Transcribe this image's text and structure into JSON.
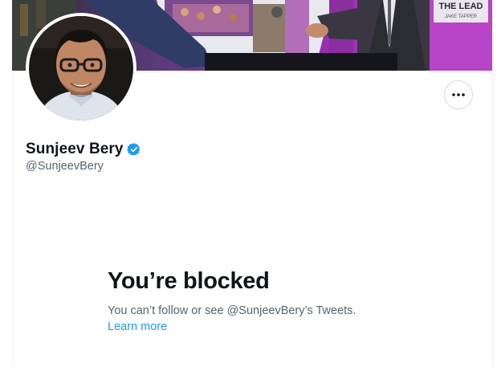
{
  "profile": {
    "display_name": "Sunjeev Bery",
    "handle": "@SunjeevBery",
    "verified_icon": "verified-badge-icon",
    "more_icon": "more-horizontal-icon"
  },
  "banner": {
    "sign_text": "THE LEAD",
    "sign_subtext": "JAKE TAPPER"
  },
  "blocked": {
    "title": "You’re blocked",
    "message": "You can’t follow or see @SunjeevBery’s Tweets.",
    "learn_more": "Learn more"
  },
  "colors": {
    "primary_text": "#0f1419",
    "secondary_text": "#536471",
    "link": "#1d9bf0",
    "border": "#cfd9de"
  }
}
